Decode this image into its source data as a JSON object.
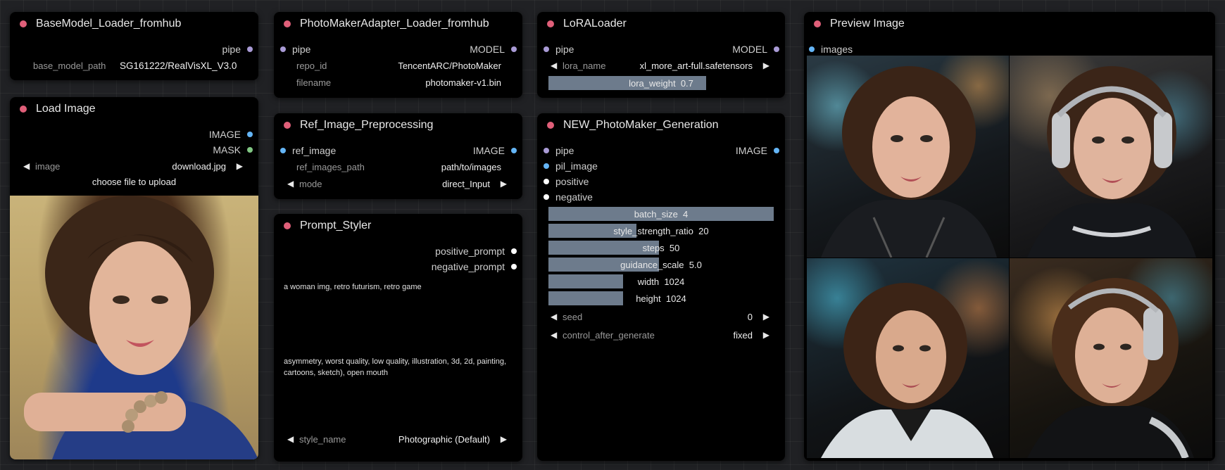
{
  "colors": {
    "canvas": "#202124",
    "node_bg": "#000000",
    "title_dot": "#e05f79",
    "slot_pipe": "#a99bd6",
    "slot_image": "#64b5f6",
    "slot_mask": "#81c784",
    "slot_cond": "#ffffff",
    "slider_fill": "#6d7b8c"
  },
  "base_model_loader": {
    "title": "BaseModel_Loader_fromhub",
    "out_pipe": "pipe",
    "base_model_path_label": "base_model_path",
    "base_model_path_value": "SG161222/RealVisXL_V3.0"
  },
  "load_image": {
    "title": "Load Image",
    "out_image": "IMAGE",
    "out_mask": "MASK",
    "image_label": "image",
    "image_value": "download.jpg",
    "upload_label": "choose file to upload"
  },
  "photomaker_adapter": {
    "title": "PhotoMakerAdapter_Loader_fromhub",
    "in_pipe": "pipe",
    "out_model": "MODEL",
    "repo_id_label": "repo_id",
    "repo_id_value": "TencentARC/PhotoMaker",
    "filename_label": "filename",
    "filename_value": "photomaker-v1.bin"
  },
  "ref_preprocess": {
    "title": "Ref_Image_Preprocessing",
    "in_ref_image": "ref_image",
    "out_image": "IMAGE",
    "path_label": "ref_images_path",
    "path_value": "path/to/images",
    "mode_label": "mode",
    "mode_value": "direct_Input"
  },
  "prompt_styler": {
    "title": "Prompt_Styler",
    "out_positive": "positive_prompt",
    "out_negative": "negative_prompt",
    "positive_text": "a woman img, retro futurism, retro game",
    "negative_text": "asymmetry, worst quality, low quality, illustration, 3d, 2d, painting, cartoons, sketch), open mouth",
    "style_label": "style_name",
    "style_value": "Photographic (Default)"
  },
  "lora_loader": {
    "title": "LoRALoader",
    "in_pipe": "pipe",
    "out_model": "MODEL",
    "lora_name_label": "lora_name",
    "lora_name_value": "xl_more_art-full.safetensors",
    "lora_weight_text": "lora_weight  0.7",
    "lora_weight_fill": 0.7
  },
  "generation": {
    "title": "NEW_PhotoMaker_Generation",
    "in_pipe": "pipe",
    "in_pil_image": "pil_image",
    "in_positive": "positive",
    "in_negative": "negative",
    "out_image": "IMAGE",
    "batch_size_text": "batch_size  4",
    "batch_size_fill": 1.0,
    "style_strength_text": "style_strength_ratio  20",
    "style_strength_fill": 0.39,
    "steps_text": "steps  50",
    "steps_fill": 0.49,
    "guidance_text": "guidance_scale  5.0",
    "guidance_fill": 0.49,
    "width_text": "width  1024",
    "width_fill": 0.33,
    "height_text": "height  1024",
    "height_fill": 0.33,
    "seed_label": "seed",
    "seed_value": "0",
    "control_label": "control_after_generate",
    "control_value": "fixed"
  },
  "preview": {
    "title": "Preview Image",
    "in_images": "images"
  }
}
